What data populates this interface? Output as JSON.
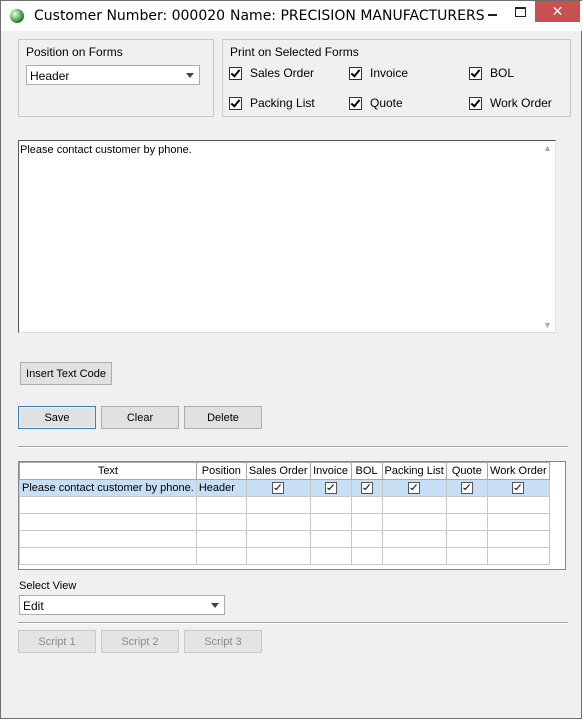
{
  "window": {
    "title": "Customer Number: 000020",
    "name_label": "Name: PRECISION MANUFACTURERS",
    "close_glyph": "✕"
  },
  "position_on_forms": {
    "label": "Position on Forms",
    "value": "Header"
  },
  "print_on_forms": {
    "label": "Print on Selected Forms",
    "options": [
      {
        "label": "Sales Order",
        "checked": true
      },
      {
        "label": "Invoice",
        "checked": true
      },
      {
        "label": "BOL",
        "checked": true
      },
      {
        "label": "Packing List",
        "checked": true
      },
      {
        "label": "Quote",
        "checked": true
      },
      {
        "label": "Work Order",
        "checked": true
      }
    ]
  },
  "memo": {
    "text": "Please contact customer by phone."
  },
  "buttons": {
    "insert_text_code": "Insert Text Code",
    "save": "Save",
    "clear": "Clear",
    "delete": "Delete"
  },
  "grid": {
    "columns": [
      "Text",
      "Position",
      "Sales Order",
      "Invoice",
      "BOL",
      "Packing List",
      "Quote",
      "Work Order"
    ],
    "rows": [
      {
        "text": "Please contact customer by phone.",
        "position": "Header",
        "sales_order": true,
        "invoice": true,
        "bol": true,
        "packing_list": true,
        "quote": true,
        "work_order": true
      }
    ]
  },
  "select_view": {
    "label": "Select View",
    "value": "Edit"
  },
  "scripts": {
    "script1": "Script 1",
    "script2": "Script 2",
    "script3": "Script 3"
  },
  "colors": {
    "selected_row": "#c6dff4",
    "close_button": "#c75050"
  }
}
